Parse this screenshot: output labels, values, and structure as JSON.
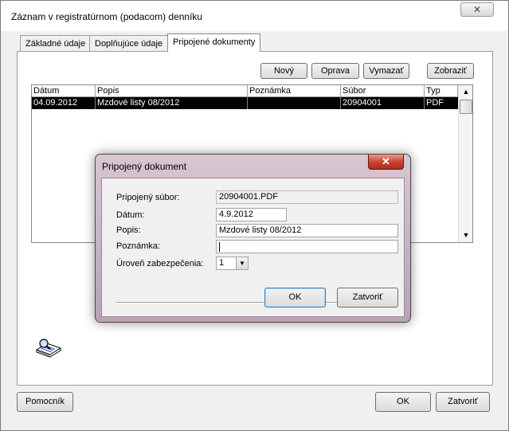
{
  "window": {
    "title": "Záznam v registratúrnom (podacom) denníku",
    "close_glyph": "✕"
  },
  "tabs": [
    {
      "label": "Základné údaje"
    },
    {
      "label": "Doplňujúce údaje"
    },
    {
      "label": "Pripojené dokumenty",
      "active": true
    }
  ],
  "toolbar": {
    "new_label": "Nový",
    "edit_label": "Oprava",
    "delete_label": "Vymazať",
    "show_label": "Zobraziť"
  },
  "grid": {
    "columns": [
      "Dátum",
      "Popis",
      "Poznámka",
      "Súbor",
      "Typ"
    ],
    "rows": [
      {
        "datum": "04.09.2012",
        "popis": "Mzdové listy 08/2012",
        "poznamka": "",
        "subor": "20904001",
        "typ": "PDF"
      }
    ],
    "scroll_up_glyph": "▲",
    "scroll_down_glyph": "▼"
  },
  "footer": {
    "help_label": "Pomocník",
    "ok_label": "OK",
    "close_label": "Zatvoriť",
    "help_icon": "help-book-magnifier-icon"
  },
  "dialog": {
    "title": "Pripojený dokument",
    "close_glyph": "✕",
    "fields": {
      "file_label": "Pripojený súbor:",
      "file_value": "20904001.PDF",
      "date_label": "Dátum:",
      "date_value": "4.9.2012",
      "desc_label": "Popis:",
      "desc_value": "Mzdové listy 08/2012",
      "note_label": "Poznámka:",
      "note_value": "",
      "security_label": "Úroveň zabezpečenia:",
      "security_value": "1",
      "security_arrow": "▼"
    },
    "ok_label": "OK",
    "close_label": "Zatvoriť"
  },
  "colors": {
    "selection": "#000000",
    "dialog_frame": "#c8b4c4",
    "close_button": "#c7412f"
  }
}
